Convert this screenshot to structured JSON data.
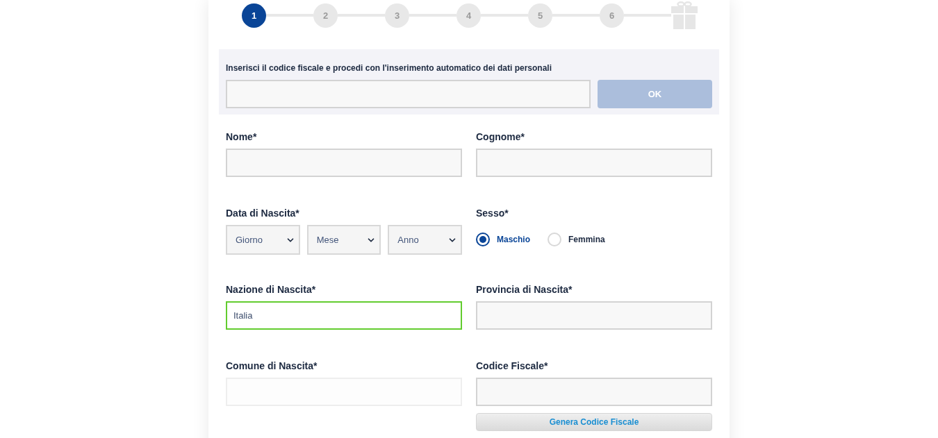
{
  "stepper": {
    "steps": [
      {
        "label": "1",
        "selected": true
      },
      {
        "label": "2",
        "selected": false
      },
      {
        "label": "3",
        "selected": false
      },
      {
        "label": "4",
        "selected": false
      },
      {
        "label": "5",
        "selected": false
      },
      {
        "label": "6",
        "selected": false
      }
    ]
  },
  "tax_code_lookup": {
    "prompt": "Inserisci il codice fiscale e procedi con l'inserimento automatico dei dati personali",
    "button": {
      "label": "OK",
      "disabled": true
    }
  },
  "fields": [
    {
      "kind": "text",
      "label": "Nome*",
      "focused": false,
      "disabled": false
    },
    {
      "kind": "text",
      "label": "Cognome*",
      "focused": false,
      "disabled": false
    },
    {
      "kind": "date",
      "label": "Data di Nascita*",
      "selects": [
        {
          "value": "Giorno"
        },
        {
          "value": "Mese"
        },
        {
          "value": "Anno"
        }
      ]
    },
    {
      "kind": "radio",
      "label": "Sesso*",
      "options": [
        {
          "label": "Maschio",
          "selected": true
        },
        {
          "label": "Femmina",
          "selected": false
        }
      ]
    },
    {
      "kind": "text",
      "label": "Nazione di Nascita*",
      "value": "Italia",
      "focused": true,
      "disabled": false
    },
    {
      "kind": "text",
      "label": "Provincia di Nascita*",
      "focused": false,
      "disabled": false
    },
    {
      "kind": "text",
      "label": "Comune di Nascita*",
      "focused": false,
      "disabled": true
    },
    {
      "kind": "text",
      "label": "Codice Fiscale*",
      "focused": false,
      "disabled": false,
      "button": "Genera Codice Fiscale"
    }
  ]
}
